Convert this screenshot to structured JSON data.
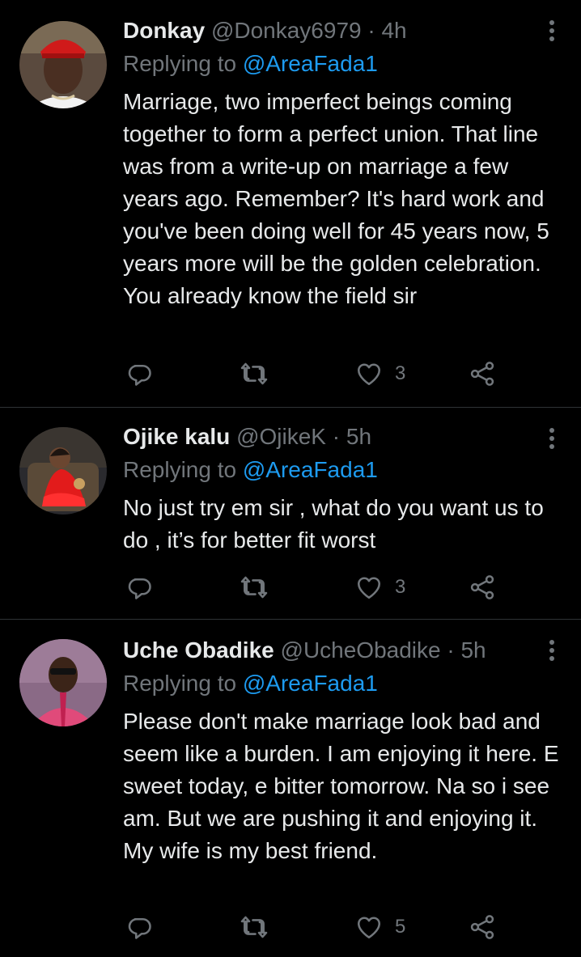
{
  "colors": {
    "background": "#000000",
    "text": "#e7e9ea",
    "muted": "#71767b",
    "link": "#1d9bf0",
    "divider": "#2f3336"
  },
  "tweets": [
    {
      "name": "Donkay",
      "handle": "@Donkay6979",
      "separator": "·",
      "time": "4h",
      "replying_prefix": "Replying to",
      "replying_to": "@AreaFada1",
      "text": "Marriage, two imperfect beings coming together to form a perfect union. That line was from a write-up on marriage a few years ago. Remember? It's hard work and you've been doing well for 45 years now, 5 years more will be the golden celebration. You already know the field sir",
      "likes": "3",
      "icons": [
        "reply-icon",
        "retweet-icon",
        "heart-icon",
        "share-icon",
        "more-icon"
      ]
    },
    {
      "name": "Ojike kalu",
      "handle": "@OjikeK",
      "separator": "·",
      "time": "5h",
      "replying_prefix": "Replying to",
      "replying_to": "@AreaFada1",
      "text": "No just try em sir , what do you want us to do , it’s for better fit worst",
      "likes": "3",
      "icons": [
        "reply-icon",
        "retweet-icon",
        "heart-icon",
        "share-icon",
        "more-icon"
      ]
    },
    {
      "name": "Uche Obadike",
      "handle": "@UcheObadike",
      "separator": "·",
      "time": "5h",
      "replying_prefix": "Replying to",
      "replying_to": "@AreaFada1",
      "text": "Please don't make marriage look bad and seem like a burden. I am enjoying it here. E sweet today, e bitter tomorrow. Na so i see am. But we are pushing it and enjoying it. My wife is my best friend.",
      "likes": "5",
      "icons": [
        "reply-icon",
        "retweet-icon",
        "heart-icon",
        "share-icon",
        "more-icon"
      ]
    }
  ]
}
